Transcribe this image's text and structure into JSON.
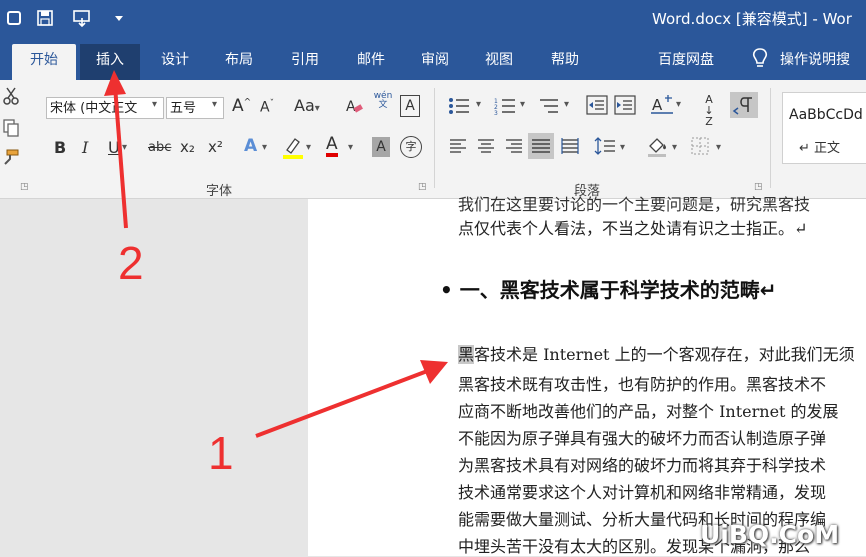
{
  "window": {
    "title": "Word.docx [兼容模式] - Wor"
  },
  "tabs": [
    {
      "label": "开始"
    },
    {
      "label": "插入"
    },
    {
      "label": "设计"
    },
    {
      "label": "布局"
    },
    {
      "label": "引用"
    },
    {
      "label": "邮件"
    },
    {
      "label": "审阅"
    },
    {
      "label": "视图"
    },
    {
      "label": "帮助"
    },
    {
      "label": "百度网盘"
    },
    {
      "label": "操作说明搜"
    }
  ],
  "ribbon": {
    "font_name": "宋体 (中文正文",
    "font_size": "五号",
    "grow_font": "A",
    "shrink_font": "A",
    "change_case": "Aa",
    "phonetic": "wén 文",
    "char_border": "A",
    "bold": "B",
    "italic": "I",
    "underline": "U",
    "strikethrough": "abc",
    "subscript": "x₂",
    "superscript": "x²",
    "text_effects": "A",
    "font_color": "A",
    "char_shading": "A",
    "enclose": "字",
    "sort": "A↓Z",
    "font_group": "字体",
    "paragraph_group": "段落",
    "style_preview": "AaBbCcDd",
    "style_name": "↵ 正文"
  },
  "colors": {
    "accent": "#2b579a",
    "highlight": "#ffff00",
    "font_red": "#e00000",
    "annotation": "#ee3030"
  },
  "document": {
    "top_line_partial": "我们在这里要讨论的一个主要问题是，研究黑客技",
    "line_2": "点仅代表个人看法，不当之处请有识之士指正。↵",
    "heading": "• 一、黑客技术属于科学技术的范畴↵",
    "cursor_char": "黑",
    "para_line_1": "客技术是 Internet 上的一个客观存在，对此我们无须",
    "lines": [
      "黑客技术既有攻击性，也有防护的作用。黑客技术不",
      "应商不断地改善他们的产品，对整个 Internet 的发展",
      "不能因为原子弹具有强大的破坏力而否认制造原子弹",
      "为黑客技术具有对网络的破坏力而将其弃于科学技术",
      "技术通常要求这个人对计算机和网络非常精通，发现",
      "能需要做大量测试、分析大量代码和长时间的程序编",
      "中埋头苦干没有太大的区别。发现某个漏洞，那么"
    ]
  },
  "annotations": {
    "label_1": "1",
    "label_2": "2"
  },
  "watermark": "UiBQ.CoM"
}
